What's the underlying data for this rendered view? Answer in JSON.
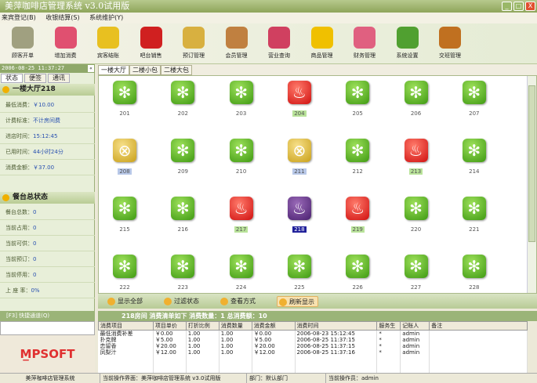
{
  "window": {
    "title": "美萍咖啡店管理系统 v3.0试用版"
  },
  "menu": [
    "来宾登记(B)",
    "收银结算(S)",
    "系统维护(Y)"
  ],
  "toolbar": [
    {
      "label": "顾客开单",
      "color": "#a0a080"
    },
    {
      "label": "增加消费",
      "color": "#e05070"
    },
    {
      "label": "宾客结账",
      "color": "#e8c020"
    },
    {
      "label": "吧台销售",
      "color": "#d02020"
    },
    {
      "label": "预订管理",
      "color": "#d8b040"
    },
    {
      "label": "会员管理",
      "color": "#c08040"
    },
    {
      "label": "营业查询",
      "color": "#d04060"
    },
    {
      "label": "商品管理",
      "color": "#f0c000"
    },
    {
      "label": "财务管理",
      "color": "#e06080"
    },
    {
      "label": "系统设置",
      "color": "#50a030"
    },
    {
      "label": "交班管理",
      "color": "#c07020"
    }
  ],
  "left": {
    "datetime": "2006-08-25 11:37:27",
    "tabs": [
      "状态",
      "便签",
      "通讯"
    ],
    "room_section": {
      "title": "一楼大厅218",
      "rows": [
        {
          "label": "最低消费：",
          "value": "￥10.00"
        },
        {
          "label": "计费标准：",
          "value": "不计房间费"
        },
        {
          "label": "进店时间：",
          "value": "15:12:45"
        },
        {
          "label": "已用时间：",
          "value": "44小时24分"
        },
        {
          "label": "消费金额：",
          "value": "￥37.00"
        }
      ]
    },
    "summary_section": {
      "title": "餐台总状态",
      "rows": [
        {
          "label": "餐台总数：",
          "value": "0"
        },
        {
          "label": "当前占用：",
          "value": "0"
        },
        {
          "label": "当前可供：",
          "value": "0"
        },
        {
          "label": "当前预订：",
          "value": "0"
        },
        {
          "label": "当前停用：",
          "value": "0"
        },
        {
          "label": "上 座 率：",
          "value": "0%"
        }
      ]
    },
    "quick_title": "[F3] 快捷通道(Q)",
    "logo": "MPSOFT"
  },
  "area_tabs": [
    "一楼大厅",
    "二楼小包",
    "二楼大包"
  ],
  "tables": [
    {
      "n": "201",
      "s": "free"
    },
    {
      "n": "202",
      "s": "free"
    },
    {
      "n": "203",
      "s": "free"
    },
    {
      "n": "204",
      "s": "busy"
    },
    {
      "n": "205",
      "s": "free"
    },
    {
      "n": "206",
      "s": "free"
    },
    {
      "n": "207",
      "s": "free"
    },
    {
      "n": "208",
      "s": "stop"
    },
    {
      "n": "209",
      "s": "free"
    },
    {
      "n": "210",
      "s": "free"
    },
    {
      "n": "211",
      "s": "stop"
    },
    {
      "n": "212",
      "s": "free"
    },
    {
      "n": "213",
      "s": "busy"
    },
    {
      "n": "214",
      "s": "free"
    },
    {
      "n": "215",
      "s": "free"
    },
    {
      "n": "216",
      "s": "free"
    },
    {
      "n": "217",
      "s": "busy"
    },
    {
      "n": "218",
      "s": "sel"
    },
    {
      "n": "219",
      "s": "busy"
    },
    {
      "n": "220",
      "s": "free"
    },
    {
      "n": "221",
      "s": "free"
    },
    {
      "n": "222",
      "s": "free"
    },
    {
      "n": "223",
      "s": "free"
    },
    {
      "n": "224",
      "s": "free"
    },
    {
      "n": "225",
      "s": "free"
    },
    {
      "n": "226",
      "s": "free"
    },
    {
      "n": "227",
      "s": "free"
    },
    {
      "n": "228",
      "s": "free"
    }
  ],
  "buttons": [
    "显示全部",
    "过滤状态",
    "查看方式",
    "刷新显示"
  ],
  "consumption": {
    "header": "218房间  消费清单如下 消费数量：1  总消费额：10",
    "columns": [
      "消费项目",
      "项目单价",
      "打折比例",
      "消费数量",
      "消费金额",
      "消费时间",
      "服务生",
      "记账人",
      "备注"
    ],
    "rows": [
      [
        "最低消费补差",
        "￥0.00",
        "1.00",
        "1.00",
        "￥0.00",
        "2006-08-23 15:12:45",
        "*",
        "admin",
        ""
      ],
      [
        "扑克牌",
        "￥5.00",
        "1.00",
        "1.00",
        "￥5.00",
        "2006-08-25 11:37:15",
        "*",
        "admin",
        ""
      ],
      [
        "恋留香",
        "￥20.00",
        "1.00",
        "1.00",
        "￥20.00",
        "2006-08-25 11:37:15",
        "*",
        "admin",
        ""
      ],
      [
        "凤梨汁",
        "￥12.00",
        "1.00",
        "1.00",
        "￥12.00",
        "2006-08-25 11:37:16",
        "*",
        "admin",
        ""
      ]
    ]
  },
  "status": [
    "美萍咖啡店管理系统",
    "当前操作界面：美萍咖啡店管理系统 v3.0试用版",
    "部门：默认部门",
    "当前操作员：admin"
  ]
}
